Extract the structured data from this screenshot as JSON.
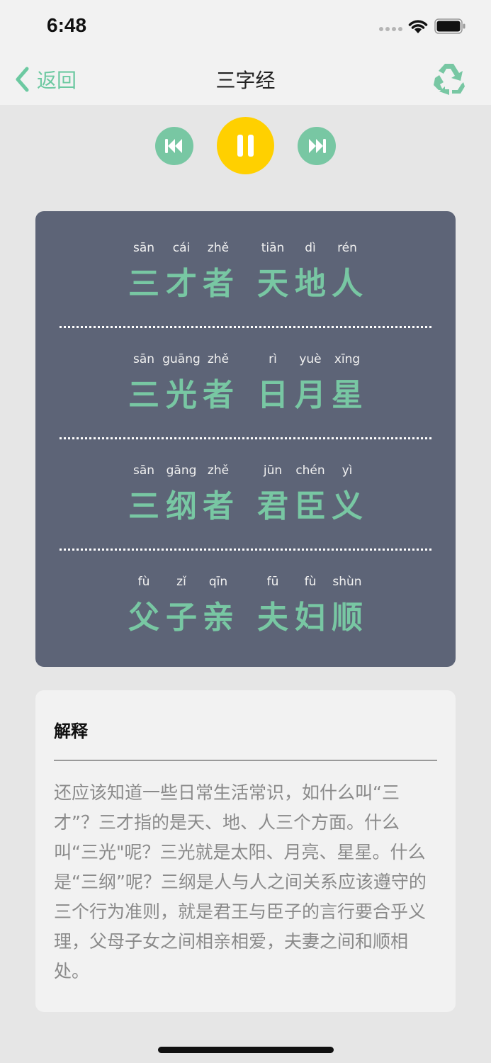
{
  "status_bar": {
    "time": "6:48"
  },
  "nav": {
    "back_label": "返回",
    "title": "三字经"
  },
  "colors": {
    "accent": "#78c7a3",
    "play": "#ffd000",
    "card": "#5d6477"
  },
  "controls": {
    "prev_icon": "rewind-icon",
    "pause_icon": "pause-icon",
    "next_icon": "fast-forward-icon"
  },
  "verses": [
    [
      {
        "pinyin": "sān",
        "hanzi": "三"
      },
      {
        "pinyin": "cái",
        "hanzi": "才"
      },
      {
        "pinyin": "zhě",
        "hanzi": "者"
      },
      {
        "pinyin": "tiān",
        "hanzi": "天"
      },
      {
        "pinyin": "dì",
        "hanzi": "地"
      },
      {
        "pinyin": "rén",
        "hanzi": "人"
      }
    ],
    [
      {
        "pinyin": "sān",
        "hanzi": "三"
      },
      {
        "pinyin": "guāng",
        "hanzi": "光"
      },
      {
        "pinyin": "zhě",
        "hanzi": "者"
      },
      {
        "pinyin": "rì",
        "hanzi": "日"
      },
      {
        "pinyin": "yuè",
        "hanzi": "月"
      },
      {
        "pinyin": "xīng",
        "hanzi": "星"
      }
    ],
    [
      {
        "pinyin": "sān",
        "hanzi": "三"
      },
      {
        "pinyin": "gāng",
        "hanzi": "纲"
      },
      {
        "pinyin": "zhě",
        "hanzi": "者"
      },
      {
        "pinyin": "jūn",
        "hanzi": "君"
      },
      {
        "pinyin": "chén",
        "hanzi": "臣"
      },
      {
        "pinyin": "yì",
        "hanzi": "义"
      }
    ],
    [
      {
        "pinyin": "fù",
        "hanzi": "父"
      },
      {
        "pinyin": "zǐ",
        "hanzi": "子"
      },
      {
        "pinyin": "qīn",
        "hanzi": "亲"
      },
      {
        "pinyin": "fū",
        "hanzi": "夫"
      },
      {
        "pinyin": "fù",
        "hanzi": "妇"
      },
      {
        "pinyin": "shùn",
        "hanzi": "顺"
      }
    ]
  ],
  "explanation": {
    "title": "解释",
    "text": "还应该知道一些日常生活常识，如什么叫“三才”？三才指的是天、地、人三个方面。什么叫“三光\"呢？三光就是太阳、月亮、星星。什么是“三纲”呢？三纲是人与人之间关系应该遵守的三个行为准则，就是君王与臣子的言行要合乎义理，父母子女之间相亲相爱，夫妻之间和顺相处。"
  }
}
